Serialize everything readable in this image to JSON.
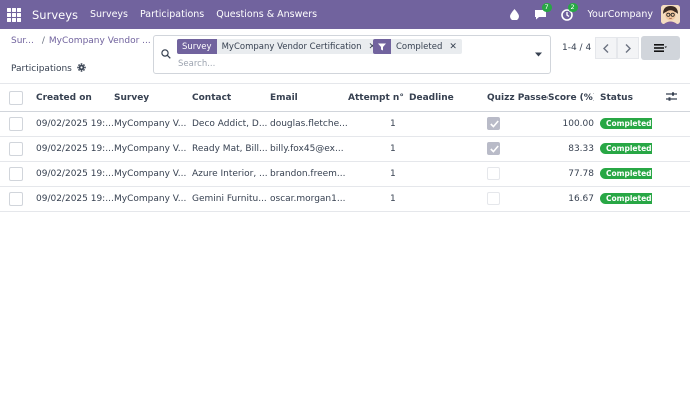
{
  "navbar": {
    "brand": "Surveys",
    "menu": [
      "Surveys",
      "Participations",
      "Questions & Answers"
    ],
    "chat_count": "7",
    "activity_count": "2",
    "company": "YourCompany"
  },
  "breadcrumb": {
    "root": "Sur...",
    "current": "MyCompany Vendor ..."
  },
  "page_title": "Participations",
  "search": {
    "facets": [
      {
        "label": "Survey",
        "value": "MyCompany Vendor Certification",
        "icon": "text-label"
      },
      {
        "label": "",
        "value": "Completed",
        "icon": "filter-icon"
      }
    ],
    "placeholder": "Search..."
  },
  "pager": "1-4 / 4",
  "table": {
    "columns": [
      "Created on",
      "Survey",
      "Contact",
      "Email",
      "Attempt n°",
      "Deadline",
      "Quizz Passed",
      "Score (%)",
      "Status"
    ],
    "rows": [
      {
        "created_on": "09/02/2025 19:...",
        "survey": "MyCompany V...",
        "contact": "Deco Addict, D...",
        "email": "douglas.fletche...",
        "attempt": "1",
        "deadline": "",
        "quizz_passed": true,
        "score": "100.00",
        "status": "Completed"
      },
      {
        "created_on": "09/02/2025 19:...",
        "survey": "MyCompany V...",
        "contact": "Ready Mat, Bill...",
        "email": "billy.fox45@ex...",
        "attempt": "1",
        "deadline": "",
        "quizz_passed": true,
        "score": "83.33",
        "status": "Completed"
      },
      {
        "created_on": "09/02/2025 19:...",
        "survey": "MyCompany V...",
        "contact": "Azure Interior, ...",
        "email": "brandon.freem...",
        "attempt": "1",
        "deadline": "",
        "quizz_passed": false,
        "score": "77.78",
        "status": "Completed"
      },
      {
        "created_on": "09/02/2025 19:...",
        "survey": "MyCompany V...",
        "contact": "Gemini Furnitu...",
        "email": "oscar.morgan1...",
        "attempt": "1",
        "deadline": "",
        "quizz_passed": false,
        "score": "16.67",
        "status": "Completed"
      }
    ]
  },
  "colors": {
    "brand": "#71639e",
    "success": "#28a745",
    "checkbox_checked": "#b9bbc8"
  }
}
